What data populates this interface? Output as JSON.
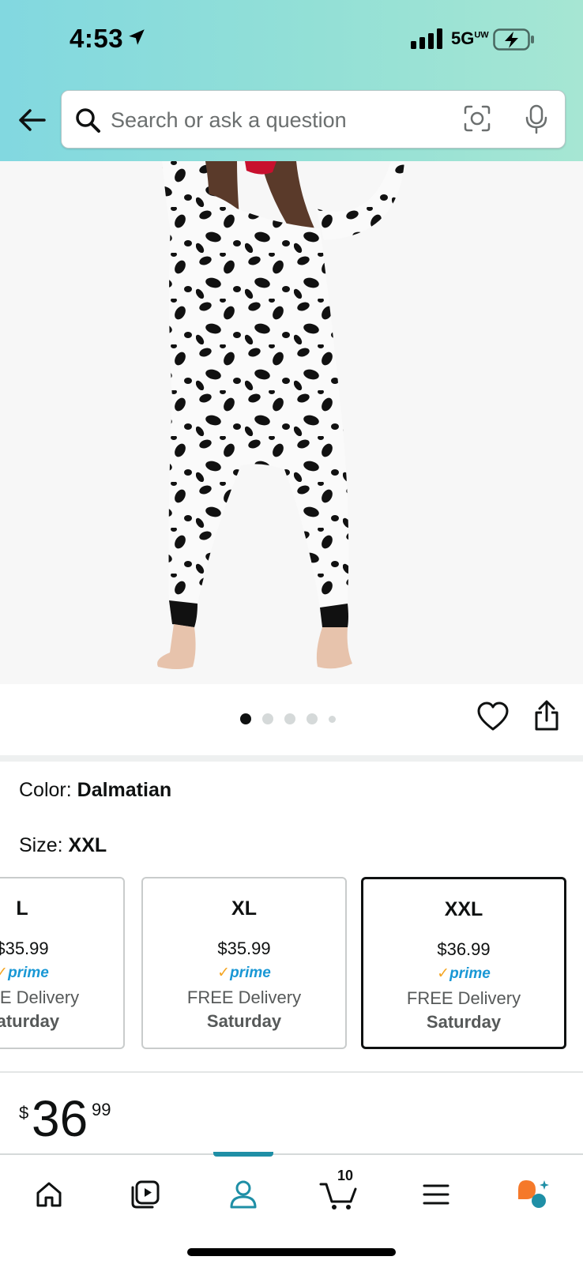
{
  "status_bar": {
    "time": "4:53",
    "network": "5G",
    "network_superscript": "UW"
  },
  "search": {
    "placeholder": "Search or ask a question"
  },
  "gallery": {
    "image_count": 5,
    "active_index": 0
  },
  "variation": {
    "color_label": "Color: ",
    "color_value": "Dalmatian",
    "size_label": "Size: ",
    "size_value": "XXL"
  },
  "size_options": [
    {
      "size": "L",
      "price": "$35.99",
      "prime": "prime",
      "delivery": "FREE Delivery",
      "day": "Saturday",
      "selected": false
    },
    {
      "size": "XL",
      "price": "$35.99",
      "prime": "prime",
      "delivery": "FREE Delivery",
      "day": "Saturday",
      "selected": false
    },
    {
      "size": "XXL",
      "price": "$36.99",
      "prime": "prime",
      "delivery": "FREE Delivery",
      "day": "Saturday",
      "selected": true
    }
  ],
  "price": {
    "currency": "$",
    "whole": "36",
    "fraction": "99"
  },
  "bottom_nav": {
    "items": [
      "home-icon",
      "video-icon",
      "account-icon",
      "cart-icon",
      "menu-icon",
      "rufus-icon"
    ],
    "active": "account-icon",
    "cart_count": "10"
  },
  "colors": {
    "header_gradient_start": "#82d8e0",
    "header_gradient_end": "#a6e6d3",
    "prime_blue": "#1a98d5",
    "prime_check": "#f5a623",
    "nav_active": "#1f8fa6",
    "rufus_orange": "#f5792a",
    "rufus_teal": "#1f8fa6"
  }
}
